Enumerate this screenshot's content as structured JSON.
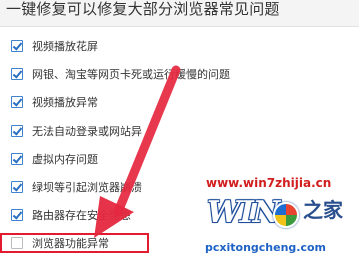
{
  "header": {
    "title": "一键修复可以修复大部分浏览器常见问题"
  },
  "items": [
    {
      "label": "视频播放花屏",
      "checked": true
    },
    {
      "label": "网银、淘宝等网页卡死或运行缓慢的问题",
      "checked": true
    },
    {
      "label": "视频播放异常",
      "checked": true
    },
    {
      "label": "无法自动登录或网站异",
      "checked": true
    },
    {
      "label": "虚拟内存问题",
      "checked": true
    },
    {
      "label": "绿坝等引起浏览器崩溃",
      "checked": true
    },
    {
      "label": "路由器存在安全隐患",
      "checked": true
    },
    {
      "label": "浏览器功能异常",
      "checked": false
    }
  ],
  "watermark": {
    "site": "www.win7zhijia.cn",
    "logo_text": "WIN",
    "logo_cn": "之家",
    "url": "pcxitongcheng.com"
  },
  "colors": {
    "accent": "#2a6fc0",
    "highlight": "#e21b2f"
  }
}
